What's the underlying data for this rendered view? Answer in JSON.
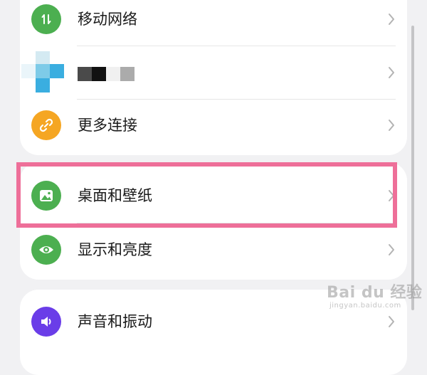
{
  "settings": {
    "items": [
      {
        "label": "移动网络",
        "icon": "mobile-network-icon",
        "color": "#4caf50"
      },
      {
        "label": "",
        "icon": "pixelated-app-icon",
        "color": "#3aaee0"
      },
      {
        "label": "更多连接",
        "icon": "link-icon",
        "color": "#f5a623"
      },
      {
        "label": "桌面和壁纸",
        "icon": "wallpaper-icon",
        "color": "#4caf50"
      },
      {
        "label": "显示和亮度",
        "icon": "eye-icon",
        "color": "#4caf50"
      },
      {
        "label": "声音和振动",
        "icon": "sound-icon",
        "color": "#6a3de8"
      }
    ]
  },
  "highlight": {
    "color": "#ee6f99"
  },
  "watermark": {
    "main": "Bai du 经验",
    "sub": "jingyan.baidu.com"
  }
}
